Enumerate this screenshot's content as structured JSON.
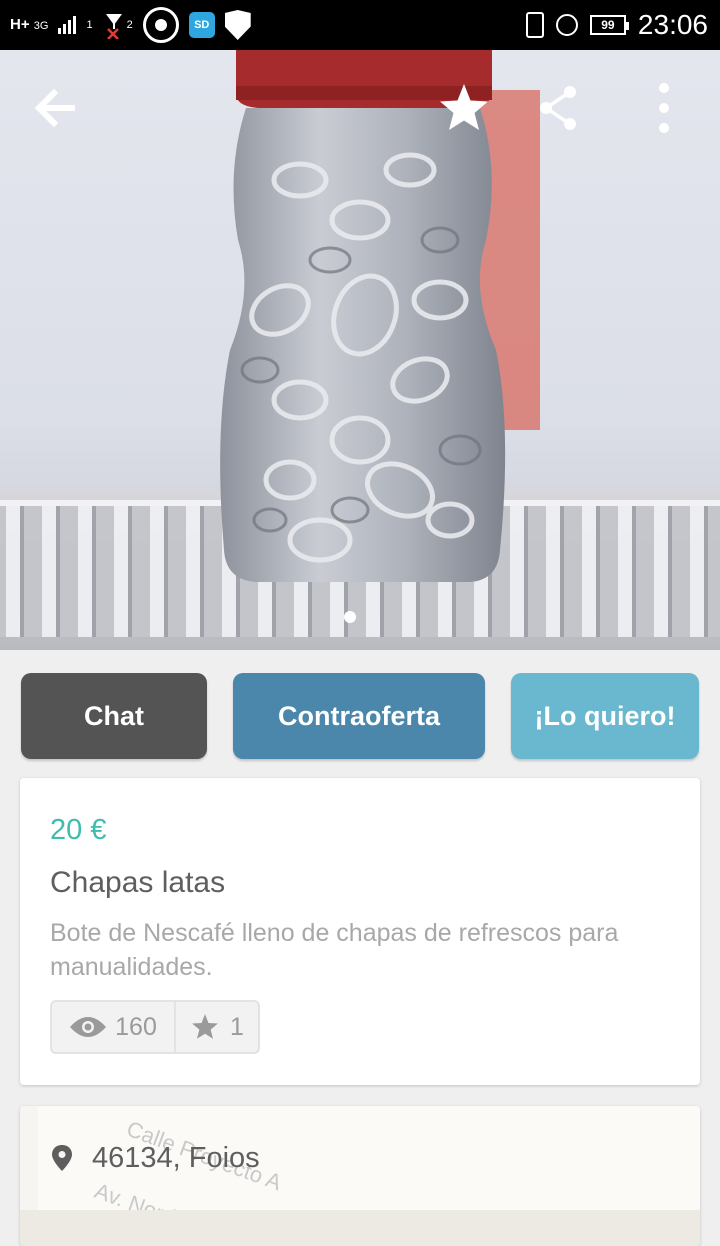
{
  "status_bar": {
    "network": "H+",
    "network_type": "3G",
    "sim1": "1",
    "sim2": "2",
    "sd_label": "SD",
    "battery": "99",
    "time": "23:06"
  },
  "photo": {
    "icons": [
      "back-arrow-icon",
      "star-icon",
      "share-icon",
      "more-vert-icon"
    ],
    "page_indicator": {
      "current": 1,
      "total": 1
    }
  },
  "actions": {
    "chat": "Chat",
    "counteroffer": "Contraoferta",
    "want": "¡Lo quiero!"
  },
  "product": {
    "price": "20 €",
    "title": "Chapas latas",
    "description": "Bote de Nescafé lleno de chapas de refrescos  para manualidades.",
    "views": "160",
    "favorites": "1"
  },
  "location": {
    "text": "46134, Foios",
    "street_1": "Calle Proyecto A",
    "street_2": "Av. Nord"
  },
  "colors": {
    "chat_button": "#545454",
    "counteroffer_button": "#4a87ab",
    "want_button": "#6ab7d0",
    "price": "#3ebdae"
  }
}
